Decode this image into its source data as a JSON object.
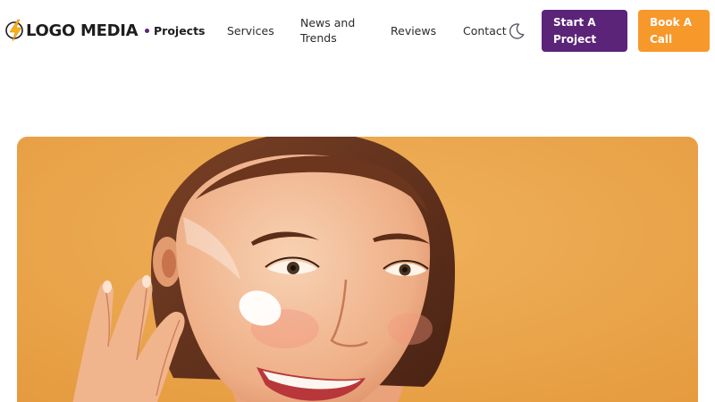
{
  "header": {
    "logo_text": "LOGO MEDIA",
    "logo_icon": "lightning-bolt-icon",
    "nav": [
      {
        "label": "Projects",
        "active": true
      },
      {
        "label": "Services",
        "active": false
      },
      {
        "label": "News and Trends",
        "active": false
      },
      {
        "label": "Reviews",
        "active": false
      },
      {
        "label": "Contact",
        "active": false
      }
    ],
    "theme_toggle_icon": "moon-icon",
    "cta_start_label": "Start A Project",
    "cta_book_label": "Book A Call"
  },
  "hero": {
    "image": "woman applying face cream on orange background"
  },
  "colors": {
    "primary_purple": "#5b2479",
    "accent_orange": "#f7982a",
    "hero_background": "#e9a84f",
    "text_dark": "#1d1d1f"
  }
}
